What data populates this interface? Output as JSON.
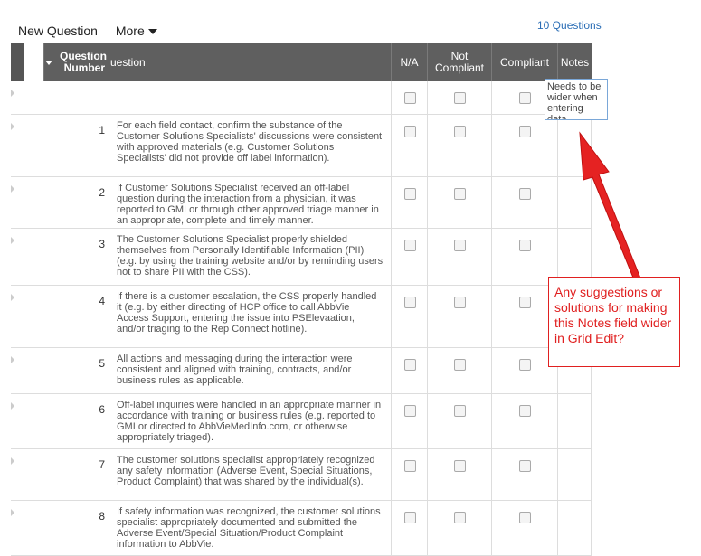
{
  "toolbar": {
    "new_question": "New Question",
    "more": "More"
  },
  "question_count": "10 Questions",
  "header": {
    "question_number": "Question Number",
    "question": "uestion",
    "na": "N/A",
    "not_compliant": "Not Compliant",
    "compliant": "Compliant",
    "notes": "Notes"
  },
  "notes_edit_value": "Needs to be wider when entering data",
  "rows": [
    {
      "num": "",
      "text": ""
    },
    {
      "num": "1",
      "text": "For each field contact, confirm the substance of the Customer Solutions Specialists' discussions were consistent with approved materials (e.g. Customer Solutions Specialists' did not provide off label information)."
    },
    {
      "num": "2",
      "text": "If Customer Solutions Specialist received an off-label question during the interaction from a physician, it was reported to GMI or through other approved triage manner in an appropriate, complete and timely manner."
    },
    {
      "num": "3",
      "text": "The Customer Solutions Specialist properly shielded themselves from Personally Identifiable Information (PII) (e.g. by using the training website and/or by reminding users not to share PII with the CSS)."
    },
    {
      "num": "4",
      "text": "If there is a customer escalation, the CSS properly handled it (e.g. by either directing of HCP office to call AbbVie Access Support, entering the issue into PSElevaation, and/or triaging to the Rep Connect hotline)."
    },
    {
      "num": "5",
      "text": "All actions and messaging during the interaction were consistent and aligned with training, contracts, and/or business rules as applicable."
    },
    {
      "num": "6",
      "text": "Off-label inquiries were handled in an appropriate manner in accordance with training or business rules (e.g. reported to GMI or directed to AbbVieMedInfo.com, or otherwise appropriately triaged)."
    },
    {
      "num": "7",
      "text": "The customer solutions specialist appropriately recognized any safety information (Adverse Event, Special Situations, Product Complaint) that was shared by the individual(s)."
    },
    {
      "num": "8",
      "text": "If safety information was recognized, the customer solutions specialist appropriately documented and submitted the Adverse Event/Special Situation/Product Complaint information to AbbVie."
    }
  ],
  "callout_text": "Any suggestions or solutions for making this Notes field wider in Grid Edit?",
  "colors": {
    "header_bg": "#5f5f5f",
    "link": "#2a6db5",
    "annotation": "#e02020"
  }
}
